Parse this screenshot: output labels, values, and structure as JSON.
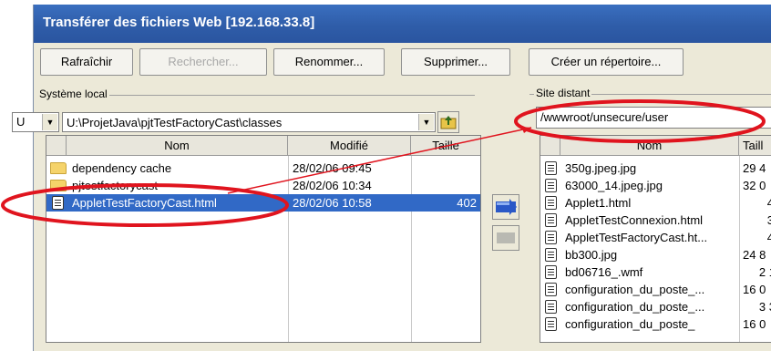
{
  "window": {
    "title": "Transférer des fichiers Web [192.168.33.8]"
  },
  "toolbar": {
    "refresh": "Rafraîchir",
    "search": "Rechercher...",
    "rename": "Renommer...",
    "delete": "Supprimer...",
    "mkdir": "Créer un répertoire..."
  },
  "local": {
    "group_label": "Système local",
    "drive": "U",
    "path": "U:\\ProjetJava\\pjtTestFactoryCast\\classes",
    "columns": {
      "name": "Nom",
      "modified": "Modifié",
      "size": "Taille"
    },
    "rows": [
      {
        "name": "dependency cache",
        "modified": "28/02/06 09:45",
        "size": "",
        "type": "folder"
      },
      {
        "name": "pjtestfactorycast",
        "modified": "28/02/06 10:34",
        "size": "",
        "type": "folder"
      },
      {
        "name": "AppletTestFactoryCast.html",
        "modified": "28/02/06 10:58",
        "size": "402",
        "type": "file",
        "selected": true
      }
    ]
  },
  "remote": {
    "group_label": "Site distant",
    "path": "/wwwroot/unsecure/user",
    "columns": {
      "name": "Nom",
      "size": "Taill"
    },
    "rows": [
      {
        "name": "350g.jpeg.jpg",
        "size": "29 4"
      },
      {
        "name": "63000_14.jpeg.jpg",
        "size": "32 0"
      },
      {
        "name": "Applet1.html",
        "size": "4"
      },
      {
        "name": "AppletTestConnexion.html",
        "size": "3"
      },
      {
        "name": "AppletTestFactoryCast.ht...",
        "size": "4"
      },
      {
        "name": "bb300.jpg",
        "size": "24 8"
      },
      {
        "name": "bd06716_.wmf",
        "size": "2 1"
      },
      {
        "name": "configuration_du_poste_...",
        "size": "16 0"
      },
      {
        "name": "configuration_du_poste_...",
        "size": "3 3"
      },
      {
        "name": "configuration_du_poste_",
        "size": "16 0"
      }
    ]
  },
  "annotation_color": "#e0141e",
  "selection_color": "#3169c6"
}
